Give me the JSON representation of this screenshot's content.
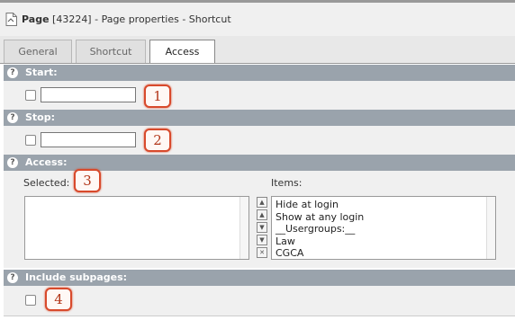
{
  "header": {
    "title_bold": "Page",
    "title_rest": " [43224] - Page properties - Shortcut",
    "icon": "document-icon"
  },
  "tabs": [
    {
      "label": "General"
    },
    {
      "label": "Shortcut"
    },
    {
      "label": "Access",
      "active": true
    }
  ],
  "sections": {
    "start": {
      "title": "Start:",
      "input_value": "",
      "badge": "1"
    },
    "stop": {
      "title": "Stop:",
      "input_value": "",
      "badge": "2"
    },
    "access": {
      "title": "Access:",
      "selected_label": "Selected:",
      "items_label": "Items:",
      "badge": "3",
      "selected_items": [],
      "items": [
        "Hide at login",
        "Show at any login",
        "__Usergroups:__",
        "Law",
        "CGCA"
      ]
    },
    "include_subpages": {
      "title": "Include subpages:",
      "badge": "4"
    }
  },
  "help_glyph": "?",
  "controls": [
    "▲",
    "▲",
    "▼",
    "▼",
    "✕"
  ],
  "colors": {
    "section_header": "#9aa3ac",
    "badge_border": "#d84a2c",
    "badge_text": "#b23518"
  }
}
